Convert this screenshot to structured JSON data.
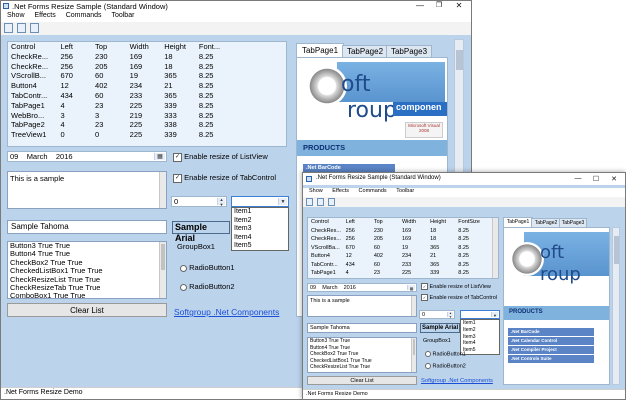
{
  "window": {
    "title": ".Net Forms Resize Sample (Standard Window)",
    "status": ".Net Forms Resize Demo"
  },
  "menu": [
    "Show",
    "Effects",
    "Commands",
    "Toolbar"
  ],
  "listview": {
    "headers": [
      "Control",
      "Left",
      "Top",
      "Width",
      "Height",
      "Font..."
    ],
    "headers_small": [
      "Control",
      "Left",
      "Top",
      "Width",
      "Height",
      "FontSize"
    ],
    "rows": [
      [
        "CheckRe...",
        "256",
        "230",
        "169",
        "18",
        "8.25"
      ],
      [
        "CheckRe...",
        "256",
        "205",
        "169",
        "18",
        "8.25"
      ],
      [
        "VScrollB...",
        "670",
        "60",
        "19",
        "365",
        "8.25"
      ],
      [
        "Button4",
        "12",
        "402",
        "234",
        "21",
        "8.25"
      ],
      [
        "TabContr...",
        "434",
        "60",
        "233",
        "365",
        "8.25"
      ],
      [
        "TabPage1",
        "4",
        "23",
        "225",
        "339",
        "8.25"
      ],
      [
        "WebBro...",
        "3",
        "3",
        "219",
        "333",
        "8.25"
      ],
      [
        "TabPage2",
        "4",
        "23",
        "225",
        "338",
        "8.25"
      ],
      [
        "TreeView1",
        "0",
        "0",
        "225",
        "339",
        "8.25"
      ]
    ],
    "rows_small": [
      [
        "CheckRes...",
        "256",
        "230",
        "169",
        "18",
        "8.25"
      ],
      [
        "CheckRes...",
        "256",
        "205",
        "169",
        "18",
        "8.25"
      ],
      [
        "VScrollBa...",
        "670",
        "60",
        "19",
        "365",
        "8.25"
      ],
      [
        "Button4",
        "12",
        "402",
        "234",
        "21",
        "8.25"
      ],
      [
        "TabContr...",
        "434",
        "60",
        "233",
        "365",
        "8.25"
      ],
      [
        "TabPage1",
        "4",
        "23",
        "225",
        "339",
        "8.25"
      ]
    ]
  },
  "date": {
    "day": "09",
    "month": "March",
    "year": "2016",
    "small": "09    March    2016"
  },
  "checkboxes": {
    "listview": "Enable resize of ListView",
    "tabcontrol": "Enable resize of TabControl"
  },
  "textbox": "This is a sample",
  "numeric": "0",
  "font_tahoma": "Sample Tahoma",
  "font_arial": "Sample Arial",
  "dropdown_items": [
    "Item1",
    "Item2",
    "Item3",
    "Item4",
    "Item5"
  ],
  "groupbox": {
    "title": "GroupBox1",
    "radio1": "RadioButton1",
    "radio2": "RadioButton2"
  },
  "log_lines": [
    "Button3 True True",
    "Button4 True True",
    "CheckBox2 True True",
    "CheckedListBox1 True True",
    "CheckResizeList True True",
    "CheckResizeTab True True",
    "ComboBox1 True True"
  ],
  "log_lines_small": [
    "Button3 True True",
    "Button4 True True",
    "CheckBox2 True True",
    "CheckedListBox1 True True",
    "CheckResizeList True True"
  ],
  "clear_button": "Clear List",
  "link": "Softgroup .Net Components",
  "tabs": [
    "TabPage1",
    "TabPage2",
    "TabPage3"
  ],
  "logo": {
    "oft": "oft",
    "roup": "roup",
    "components": "componen",
    "badge": "Microsoft Visual 2008"
  },
  "products": "PRODUCTS",
  "nav": [
    ".Net BarCode",
    ".Net Calendar Control",
    ".Net Compiler Project",
    ".Net Controls Suite"
  ],
  "colors": {
    "window_bg": "#bcd3ec",
    "link": "#1a4fd6",
    "nav_bg": "#5b84c6",
    "products_band": "#7fb2dc"
  }
}
